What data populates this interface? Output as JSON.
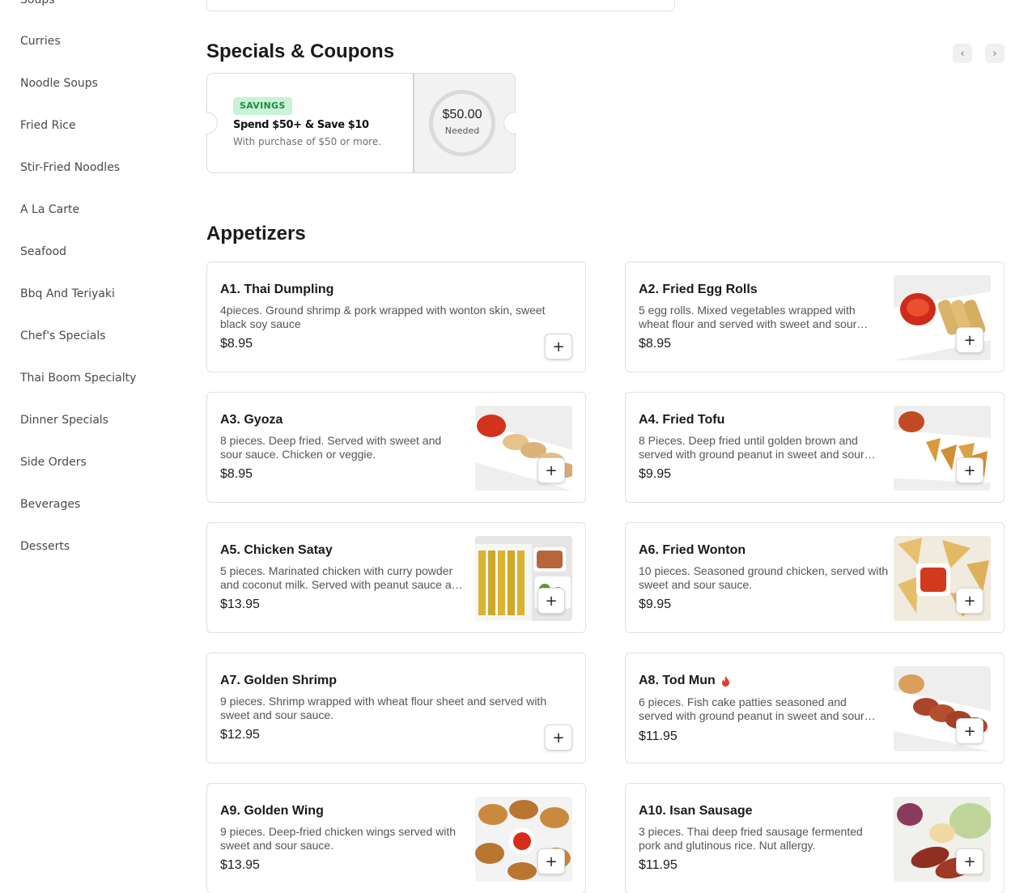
{
  "sidebar": {
    "items": [
      {
        "label": "Soups"
      },
      {
        "label": "Curries"
      },
      {
        "label": "Noodle Soups"
      },
      {
        "label": "Fried Rice"
      },
      {
        "label": "Stir-Fried Noodles"
      },
      {
        "label": "A La Carte"
      },
      {
        "label": "Seafood"
      },
      {
        "label": "Bbq And Teriyaki"
      },
      {
        "label": "Chef's Specials"
      },
      {
        "label": "Thai Boom Specialty"
      },
      {
        "label": "Dinner Specials"
      },
      {
        "label": "Side Orders"
      },
      {
        "label": "Beverages"
      },
      {
        "label": "Desserts"
      }
    ]
  },
  "specials": {
    "title": "Specials & Coupons",
    "prev_icon": "‹",
    "next_icon": "›",
    "coupon": {
      "badge": "SAVINGS",
      "title": "Spend $50+ & Save $10",
      "subtitle": "With purchase of $50 or more.",
      "amount": "$50.00",
      "amount_label": "Needed",
      "progress": 0
    }
  },
  "appetizers": {
    "title": "Appetizers",
    "add_icon": "+",
    "items": [
      {
        "name": "A1. Thai Dumpling",
        "desc": "4pieces. Ground shrimp & pork wrapped with wonton skin, sweet black soy sauce",
        "price": "$8.95",
        "image": "none"
      },
      {
        "name": "A2. Fried Egg Rolls",
        "desc": "5 egg rolls. Mixed vegetables wrapped with wheat flour and served with sweet and sour sauce.",
        "price": "$8.95",
        "image": "egg-rolls-photo"
      },
      {
        "name": "A3. Gyoza",
        "desc": "8 pieces. Deep fried. Served with sweet and sour sauce. Chicken or veggie.",
        "price": "$8.95",
        "image": "gyoza-photo"
      },
      {
        "name": "A4. Fried Tofu",
        "desc": "8 Pieces. Deep fried until golden brown and served with ground peanut in sweet and sour sauce.",
        "price": "$9.95",
        "image": "fried-tofu-photo"
      },
      {
        "name": "A5. Chicken Satay",
        "desc": "5 pieces. Marinated chicken with curry powder and coconut milk. Served with peanut sauce and cucumber salad.",
        "price": "$13.95",
        "image": "satay-photo"
      },
      {
        "name": "A6. Fried Wonton",
        "desc": "10 pieces. Seasoned ground chicken, served with sweet and sour sauce.",
        "price": "$9.95",
        "image": "wonton-photo"
      },
      {
        "name": "A7. Golden Shrimp",
        "desc": "9 pieces. Shrimp wrapped with wheat flour sheet and served with sweet and sour sauce.",
        "price": "$12.95",
        "image": "none"
      },
      {
        "name": "A8. Tod Mun",
        "desc": "6 pieces. Fish cake patties seasoned and served with ground peanut in sweet and sour sauce. Spicy.",
        "price": "$11.95",
        "image": "tod-mun-photo",
        "spicy": true
      },
      {
        "name": "A9. Golden Wing",
        "desc": "9 pieces. Deep-fried chicken wings served with sweet and sour sauce.",
        "price": "$13.95",
        "image": "wings-photo"
      },
      {
        "name": "A10. Isan Sausage",
        "desc": "3 pieces. Thai deep fried sausage fermented pork and glutinous rice. Nut allergy.",
        "price": "$11.95",
        "image": "sausage-photo"
      }
    ]
  },
  "colors": {
    "badge_bg": "#c9f2d6",
    "badge_text": "#1e8a45",
    "spicy": "#e03b2e"
  }
}
